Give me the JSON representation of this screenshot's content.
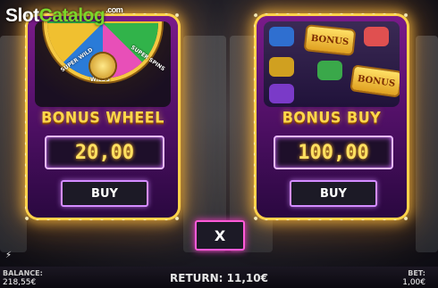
{
  "brand": {
    "name_part1": "Slot",
    "name_part2": "Catalog",
    "domain_suffix": ".com"
  },
  "left_panel": {
    "title": "BONUS WHEEL",
    "price": "20,00",
    "buy_label": "BUY",
    "wheel_segments": [
      "SUPER WILD",
      "WILDS",
      "SUPER SPINS"
    ]
  },
  "right_panel": {
    "title": "BONUS BUY",
    "price": "100,00",
    "buy_label": "BUY",
    "tile_text": "BONUS"
  },
  "close_label": "X",
  "footer": {
    "balance_label": "BALANCE:",
    "balance_value": "218,55€",
    "return_label": "RETURN: 11,10€",
    "bet_label": "BET:",
    "bet_value": "1,00€"
  },
  "colors": {
    "gold": "#ffd84a",
    "panel_purple": "#7a1b8a",
    "neon_pink": "#ff5ad8",
    "logo_green": "#7bd62a"
  },
  "icons": [
    "lightning-icon",
    "close-icon"
  ]
}
